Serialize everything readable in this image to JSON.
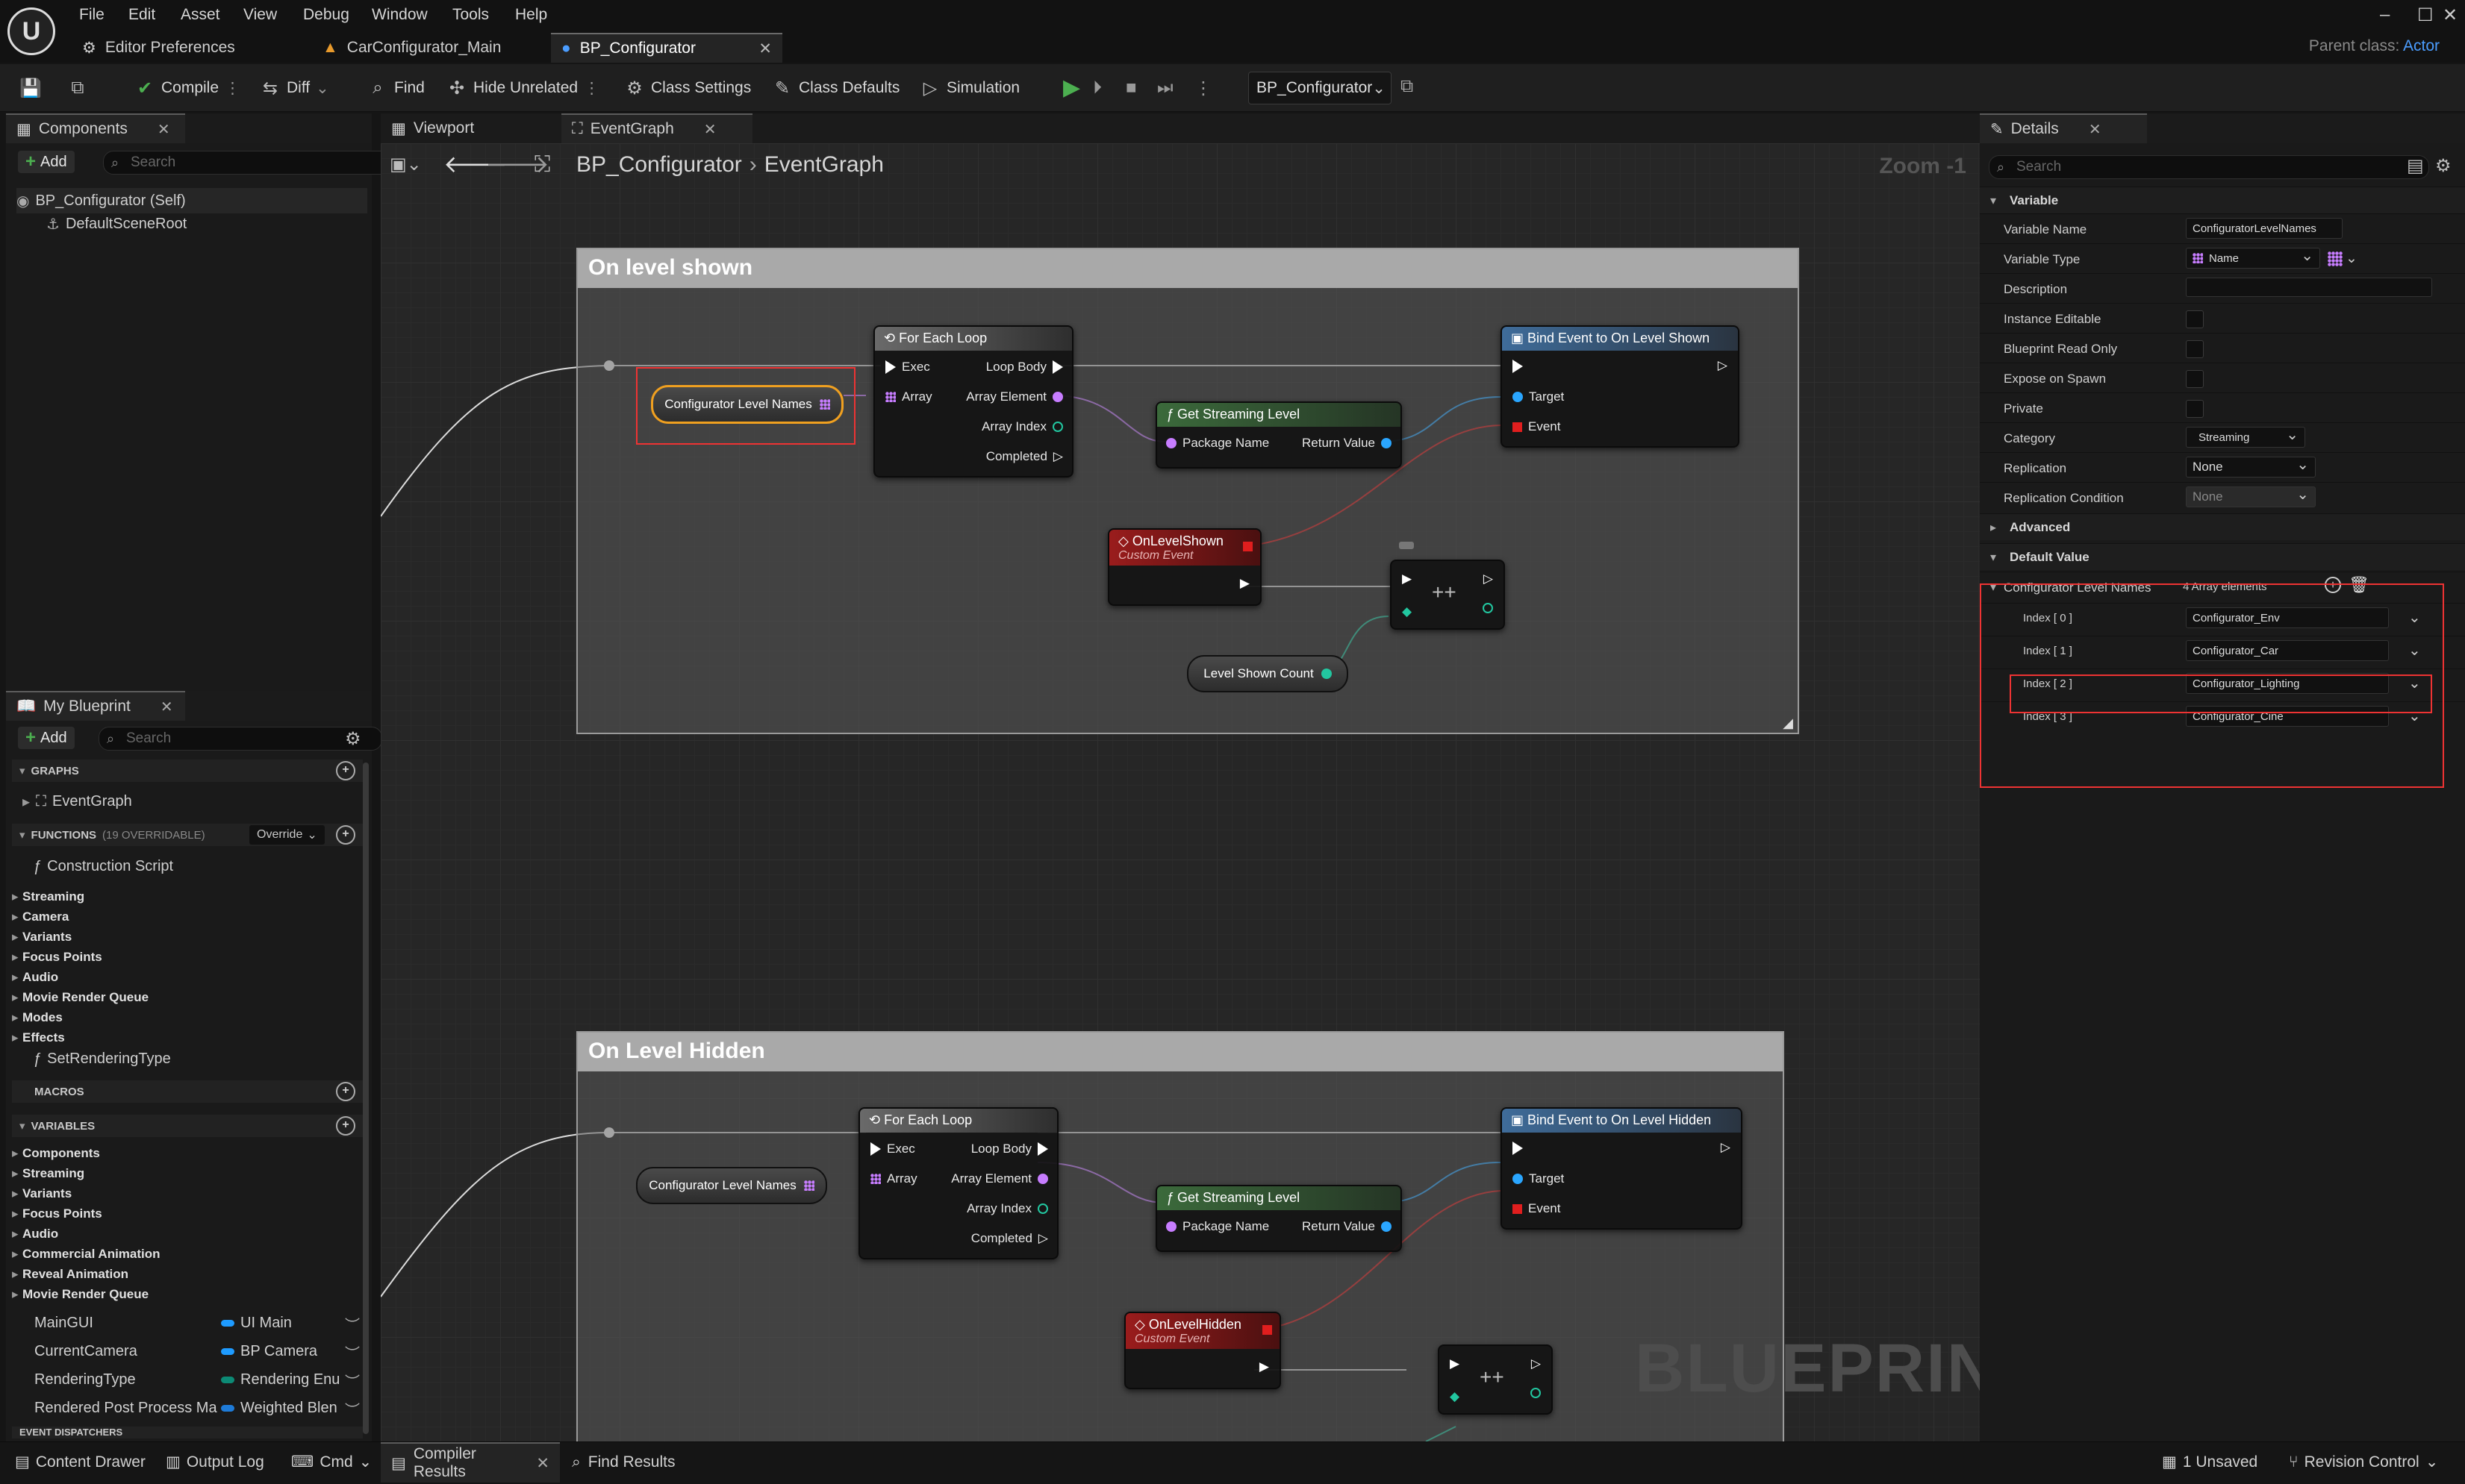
{
  "menu": [
    "File",
    "Edit",
    "Asset",
    "View",
    "Debug",
    "Window",
    "Tools",
    "Help"
  ],
  "doc_tabs": [
    "Editor Preferences",
    "CarConfigurator_Main",
    "BP_Configurator"
  ],
  "parent_class": {
    "label": "Parent class:",
    "value": "Actor"
  },
  "toolbar": {
    "compile": "Compile",
    "diff": "Diff",
    "find": "Find",
    "hide_unrelated": "Hide Unrelated",
    "class_settings": "Class Settings",
    "class_defaults": "Class Defaults",
    "simulation": "Simulation",
    "debug_object": "BP_Configurator"
  },
  "components": {
    "tab": "Components",
    "add": "Add",
    "search_placeholder": "Search",
    "items": [
      "BP_Configurator (Self)",
      "DefaultSceneRoot"
    ]
  },
  "graph": {
    "tabs": [
      "Viewport",
      "EventGraph"
    ],
    "breadcrumb": [
      "BP_Configurator",
      "EventGraph"
    ],
    "zoom": "Zoom -1",
    "watermark": "BLUEPRINT",
    "comments": [
      "On level shown",
      "On Level Hidden"
    ],
    "nodes": {
      "for_each": "For Each Loop",
      "exec": "Exec",
      "loop_body": "Loop Body",
      "array": "Array",
      "array_element": "Array Element",
      "array_index": "Array Index",
      "completed": "Completed",
      "get_streaming": "Get Streaming Level",
      "package_name": "Package Name",
      "return_value": "Return Value",
      "bind_shown": "Bind Event to On Level Shown",
      "bind_hidden": "Bind Event to On Level Hidden",
      "target": "Target",
      "event": "Event",
      "on_shown": "OnLevelShown",
      "on_hidden": "OnLevelHidden",
      "custom_event": "Custom Event",
      "config_names": "Configurator Level Names",
      "shown_count": "Level Shown Count",
      "increment": "++"
    }
  },
  "my_blueprint": {
    "tab": "My Blueprint",
    "add": "Add",
    "search_placeholder": "Search",
    "graphs_header": "GRAPHS",
    "graphs": [
      "EventGraph"
    ],
    "functions_header": "FUNCTIONS",
    "functions_note": "(19 OVERRIDABLE)",
    "override": "Override",
    "construction": "Construction Script",
    "function_cats": [
      "Streaming",
      "Camera",
      "Variants",
      "Focus Points",
      "Audio",
      "Movie Render Queue",
      "Modes",
      "Effects"
    ],
    "set_rendering": "SetRenderingType",
    "macros_header": "MACROS",
    "variables_header": "VARIABLES",
    "variable_cats": [
      "Components",
      "Streaming",
      "Variants",
      "Focus Points",
      "Audio",
      "Commercial Animation",
      "Reveal Animation",
      "Movie Render Queue"
    ],
    "variables": [
      {
        "name": "MainGUI",
        "type": "UI Main",
        "color": "#1e9bff"
      },
      {
        "name": "CurrentCamera",
        "type": "BP Camera",
        "color": "#1e9bff"
      },
      {
        "name": "RenderingType",
        "type": "Rendering Enu",
        "color": "#0c8a75"
      },
      {
        "name": "Rendered Post Process Ma",
        "type": "Weighted Blen",
        "color": "#1e7bd8"
      }
    ],
    "event_dispatchers": "EVENT DISPATCHERS"
  },
  "details": {
    "tab": "Details",
    "search_placeholder": "Search",
    "variable_section": "Variable",
    "rows": [
      {
        "label": "Variable Name",
        "value": "ConfiguratorLevelNames"
      },
      {
        "label": "Variable Type",
        "value": "Name"
      },
      {
        "label": "Description",
        "value": ""
      },
      {
        "label": "Instance Editable",
        "value": ""
      },
      {
        "label": "Blueprint Read Only",
        "value": ""
      },
      {
        "label": "Expose on Spawn",
        "value": ""
      },
      {
        "label": "Private",
        "value": ""
      },
      {
        "label": "Category",
        "value": "Streaming"
      },
      {
        "label": "Replication",
        "value": "None"
      },
      {
        "label": "Replication Condition",
        "value": "None"
      }
    ],
    "advanced": "Advanced",
    "default_value_section": "Default Value",
    "array_label": "Configurator Level Names",
    "array_count": "4 Array elements",
    "array": [
      {
        "index": "Index [ 0 ]",
        "value": "Configurator_Env"
      },
      {
        "index": "Index [ 1 ]",
        "value": "Configurator_Car"
      },
      {
        "index": "Index [ 2 ]",
        "value": "Configurator_Lighting"
      },
      {
        "index": "Index [ 3 ]",
        "value": "Configurator_Cine"
      }
    ]
  },
  "statusbar": {
    "content_drawer": "Content Drawer",
    "output_log": "Output Log",
    "cmd": "Cmd",
    "compiler_results": "Compiler Results",
    "find_results": "Find Results",
    "unsaved": "1 Unsaved",
    "revision_control": "Revision Control"
  },
  "colors": {
    "accent": "#4b9dff",
    "highlight": "#e33333",
    "play": "#4caf50"
  }
}
